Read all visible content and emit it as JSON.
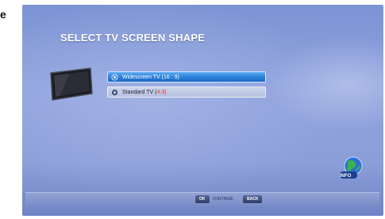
{
  "edge_letter": "e",
  "screen": {
    "title": "SELECT TV SCREEN SHAPE",
    "options": [
      {
        "prefix": "Widescreen TV (16 : 9)",
        "suffix": "",
        "selected": true
      },
      {
        "prefix": "Standard TV (",
        "suffix": "4:3)",
        "selected": false
      }
    ],
    "info_label": "INFO"
  },
  "footer": {
    "ok_key": "OK",
    "ok_text": "CONTINUE",
    "back_key": "BACK"
  },
  "colors": {
    "background": "#8c9ed8",
    "selected_option": "#2b7fd8",
    "highlight_text": "#e23030"
  }
}
